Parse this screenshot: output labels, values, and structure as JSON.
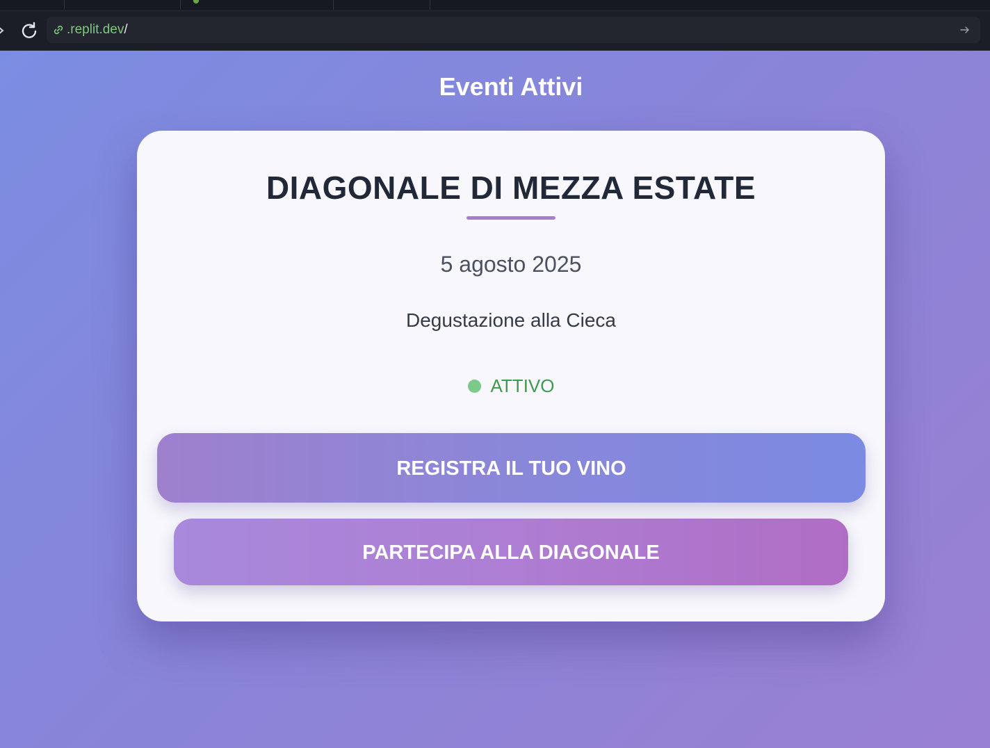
{
  "browser": {
    "url_host": ".replit.dev",
    "url_path": "/"
  },
  "page": {
    "title": "Eventi Attivi"
  },
  "event": {
    "name": "DIAGONALE DI MEZZA ESTATE",
    "date": "5 agosto 2025",
    "description": "Degustazione alla Cieca",
    "status": "ATTIVO",
    "status_color": "#7cc98a"
  },
  "actions": {
    "register_label": "REGISTRA IL TUO VINO",
    "join_label": "PARTECIPA ALLA DIAGONALE"
  },
  "colors": {
    "background_start": "#7b8de2",
    "background_end": "#9a80d2",
    "card": "#f7f7fc",
    "accent": "#a57fcf"
  }
}
